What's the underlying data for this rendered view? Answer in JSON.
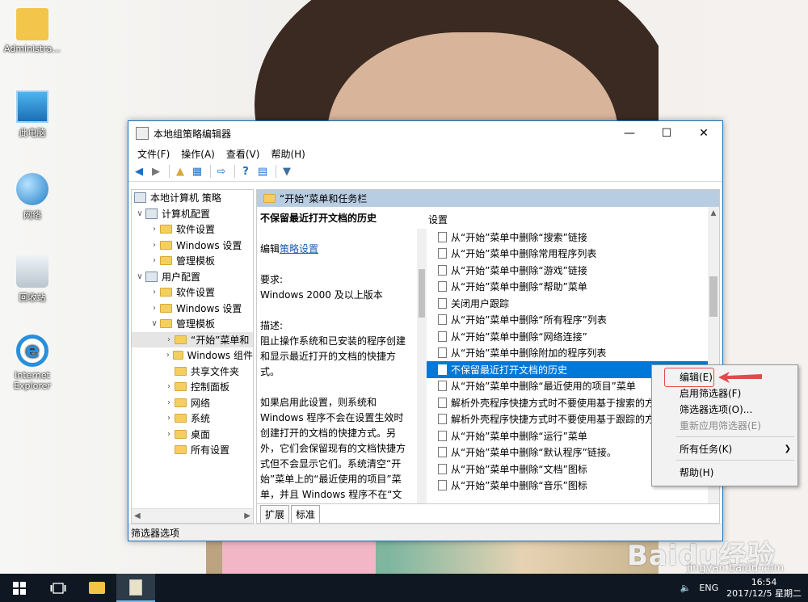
{
  "desktop": {
    "icons": [
      {
        "label": "Administra..."
      },
      {
        "label": "此电脑"
      },
      {
        "label": "网络"
      },
      {
        "label": "回收站"
      },
      {
        "label": "Internet Explorer"
      }
    ],
    "watermark": "Baidu经验",
    "watermark_url": "jingyan.baidu.com"
  },
  "window": {
    "title": "本地组策略编辑器",
    "controls": {
      "minimize": "—",
      "maximize": "☐",
      "close": "✕"
    },
    "menu": [
      "文件(F)",
      "操作(A)",
      "查看(V)",
      "帮助(H)"
    ],
    "tree": {
      "root": "本地计算机 策略",
      "items": [
        {
          "label": "计算机配置",
          "level": 1,
          "expanded": true,
          "icon": "computer-icon"
        },
        {
          "label": "软件设置",
          "level": 2,
          "expanded": false,
          "icon": "folder-icon"
        },
        {
          "label": "Windows 设置",
          "level": 2,
          "expanded": false,
          "icon": "folder-icon"
        },
        {
          "label": "管理模板",
          "level": 2,
          "expanded": false,
          "icon": "folder-icon"
        },
        {
          "label": "用户配置",
          "level": 1,
          "expanded": true,
          "icon": "user-icon"
        },
        {
          "label": "软件设置",
          "level": 2,
          "expanded": false,
          "icon": "folder-icon"
        },
        {
          "label": "Windows 设置",
          "level": 2,
          "expanded": false,
          "icon": "folder-icon"
        },
        {
          "label": "管理模板",
          "level": 2,
          "expanded": true,
          "icon": "folder-icon"
        },
        {
          "label": "“开始”菜单和",
          "level": 3,
          "expanded": false,
          "icon": "folder-icon",
          "selected": true
        },
        {
          "label": "Windows 组件",
          "level": 3,
          "expanded": false,
          "icon": "folder-icon"
        },
        {
          "label": "共享文件夹",
          "level": 3,
          "expanded": null,
          "icon": "folder-icon"
        },
        {
          "label": "控制面板",
          "level": 3,
          "expanded": false,
          "icon": "folder-icon"
        },
        {
          "label": "网络",
          "level": 3,
          "expanded": false,
          "icon": "folder-icon"
        },
        {
          "label": "系统",
          "level": 3,
          "expanded": false,
          "icon": "folder-icon"
        },
        {
          "label": "桌面",
          "level": 3,
          "expanded": false,
          "icon": "folder-icon"
        },
        {
          "label": "所有设置",
          "level": 3,
          "expanded": null,
          "icon": "folder-icon"
        }
      ]
    },
    "right_header": "“开始”菜单和任务栏",
    "description": {
      "title": "不保留最近打开文档的历史",
      "edit_prefix": "编辑",
      "edit_link": "策略设置",
      "req_label": "要求:",
      "req_value": "Windows 2000 及以上版本",
      "desc_label": "描述:",
      "desc_text": "阻止操作系统和已安装的程序创建和显示最近打开的文档的快捷方式。",
      "desc_text2": "如果启用此设置，则系统和 Windows 程序不会在设置生效时创建打开的文档的快捷方式。另外，它们会保留现有的文档快捷方式但不会显示它们。系统清空“开始”菜单上的“最近使用的项目”菜单，并且 Windows 程序不在“文件”菜单底部显示快捷方式。此外，“开始”菜单和任务栏中的程序的跳转列表不会显示最近或常用的文"
    },
    "settings_header": "设置",
    "settings": [
      "从“开始”菜单中删除“搜索”链接",
      "从“开始”菜单中删除常用程序列表",
      "从“开始”菜单中删除“游戏”链接",
      "从“开始”菜单中删除“帮助”菜单",
      "关闭用户跟踪",
      "从“开始”菜单中删除“所有程序”列表",
      "从“开始”菜单中删除“网络连接”",
      "从“开始”菜单中删除附加的程序列表",
      "不保留最近打开文档的历史",
      "从“开始”菜单中删除“最近使用的项目”菜单",
      "解析外壳程序快捷方式时不要使用基于搜索的方法",
      "解析外壳程序快捷方式时不要使用基于跟踪的方法",
      "从“开始”菜单中删除“运行”菜单",
      "从“开始”菜单中删除“默认程序”链接。",
      "从“开始”菜单中删除“文档”图标",
      "从“开始”菜单中删除“音乐”图标"
    ],
    "selected_setting_index": 8,
    "tabs": [
      "扩展",
      "标准"
    ],
    "status": "筛选器选项"
  },
  "context_menu": {
    "items": [
      {
        "label": "编辑(E)",
        "disabled": false
      },
      {
        "label": "启用筛选器(F)",
        "disabled": false
      },
      {
        "label": "筛选器选项(O)...",
        "disabled": false
      },
      {
        "label": "重新应用筛选器(E)",
        "disabled": true
      },
      {
        "label": "所有任务(K)",
        "disabled": false,
        "submenu": true
      },
      {
        "label": "帮助(H)",
        "disabled": false
      }
    ]
  },
  "taskbar": {
    "lang": "ENG",
    "time": "16:54",
    "date": "2017/12/5 星期二"
  },
  "colors": {
    "selection": "#0078d7",
    "header": "#b9cde2",
    "annotation": "#e34a4a"
  }
}
